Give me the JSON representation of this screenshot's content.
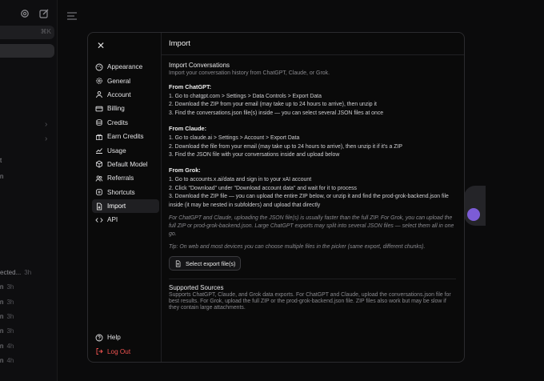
{
  "background": {
    "search_shortcut": "⌘K",
    "fragments": [
      {
        "text": "t",
        "age": ""
      },
      {
        "text": "n",
        "age": ""
      },
      {
        "text": "ected...",
        "age": "3h"
      },
      {
        "text": "n",
        "age": "3h"
      },
      {
        "text": "n",
        "age": "3h"
      },
      {
        "text": "n",
        "age": "3h"
      },
      {
        "text": "n",
        "age": "3h"
      },
      {
        "text": "n",
        "age": "4h"
      },
      {
        "text": "n",
        "age": "4h"
      }
    ],
    "accent": "#7c5cd6"
  },
  "modal": {
    "nav": [
      {
        "label": "Appearance",
        "icon": "palette-icon",
        "name": "nav-appearance"
      },
      {
        "label": "General",
        "icon": "gear-icon",
        "name": "nav-general"
      },
      {
        "label": "Account",
        "icon": "user-icon",
        "name": "nav-account"
      },
      {
        "label": "Billing",
        "icon": "card-icon",
        "name": "nav-billing"
      },
      {
        "label": "Credits",
        "icon": "coins-icon",
        "name": "nav-credits"
      },
      {
        "label": "Earn Credits",
        "icon": "gift-icon",
        "name": "nav-earn-credits"
      },
      {
        "label": "Usage",
        "icon": "chart-icon",
        "name": "nav-usage"
      },
      {
        "label": "Default Model",
        "icon": "cube-icon",
        "name": "nav-default-model"
      },
      {
        "label": "Referrals",
        "icon": "users-icon",
        "name": "nav-referrals"
      },
      {
        "label": "Shortcuts",
        "icon": "keyboard-icon",
        "name": "nav-shortcuts"
      },
      {
        "label": "Import",
        "icon": "import-icon",
        "name": "nav-import"
      },
      {
        "label": "API",
        "icon": "code-icon",
        "name": "nav-api"
      }
    ],
    "active_nav": "Import",
    "bottom_nav": {
      "help": "Help",
      "logout": "Log Out"
    },
    "logout_color": "#ef5350",
    "header": "Import",
    "import_section": {
      "title": "Import Conversations",
      "subtitle": "Import your conversation history from ChatGPT, Claude, or Grok.",
      "chatgpt": {
        "title": "From ChatGPT:",
        "steps": [
          "1. Go to chatgpt.com > Settings > Data Controls > Export Data",
          "2. Download the ZIP from your email (may take up to 24 hours to arrive), then unzip it",
          "3. Find the conversations.json file(s) inside — you can select several JSON files at once"
        ]
      },
      "claude": {
        "title": "From Claude:",
        "steps": [
          "1. Go to claude.ai > Settings > Account > Export Data",
          "2. Download the file from your email (may take up to 24 hours to arrive), then unzip it if it's a ZIP",
          "3. Find the JSON file with your conversations inside and upload below"
        ]
      },
      "grok": {
        "title": "From Grok:",
        "steps": [
          "1. Go to accounts.x.ai/data and sign in to your xAI account",
          "2. Click \"Download\" under \"Download account data\" and wait for it to process",
          "3. Download the ZIP file — you can upload the entire ZIP below, or unzip it and find the prod-grok-backend.json file inside (it may be nested in subfolders) and upload that directly"
        ]
      },
      "note": "For ChatGPT and Claude, uploading the JSON file(s) is usually faster than the full ZIP. For Grok, you can upload the full ZIP or prod-grok-backend.json. Large ChatGPT exports may split into several JSON files — select them all in one go.",
      "tip": "Tip: On web and most devices you can choose multiple files in the picker (same export, different chunks).",
      "button": "Select export file(s)"
    },
    "supported": {
      "title": "Supported Sources",
      "text": "Supports ChatGPT, Claude, and Grok data exports. For ChatGPT and Claude, upload the conversations.json file for best results. For Grok, upload the full ZIP or the prod-grok-backend.json file. ZIP files also work but may be slow if they contain large attachments."
    }
  }
}
